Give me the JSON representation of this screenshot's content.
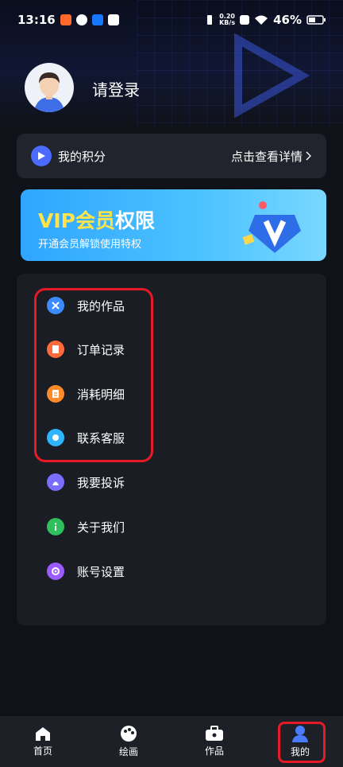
{
  "status_bar": {
    "time": "13:16",
    "net_speed": "0.20",
    "net_unit": "KB/s",
    "battery": "46%"
  },
  "profile": {
    "login_label": "请登录"
  },
  "points": {
    "label": "我的积分",
    "detail_link": "点击查看详情"
  },
  "vip": {
    "title_a": "VIP",
    "title_b": "会员",
    "title_c": "权限",
    "subtitle": "开通会员解锁使用特权"
  },
  "menu": {
    "items": [
      {
        "label": "我的作品",
        "icon": "works-icon",
        "color": "#3b8cff"
      },
      {
        "label": "订单记录",
        "icon": "order-icon",
        "color": "#ff6a3d"
      },
      {
        "label": "消耗明细",
        "icon": "consumption-icon",
        "color": "#ff8a2a"
      },
      {
        "label": "联系客服",
        "icon": "customer-service-icon",
        "color": "#2fb4ff"
      },
      {
        "label": "我要投诉",
        "icon": "complaint-icon",
        "color": "#7b6dff"
      },
      {
        "label": "关于我们",
        "icon": "about-icon",
        "color": "#2fbf5c"
      },
      {
        "label": "账号设置",
        "icon": "settings-icon",
        "color": "#9b5cff"
      }
    ]
  },
  "tabs": [
    {
      "label": "首页",
      "icon": "home-icon"
    },
    {
      "label": "绘画",
      "icon": "palette-icon"
    },
    {
      "label": "作品",
      "icon": "briefcase-icon"
    },
    {
      "label": "我的",
      "icon": "user-icon"
    }
  ],
  "colors": {
    "accent": "#4b6bff",
    "highlight": "#e81a25",
    "active_tab": "#4b7bff"
  }
}
